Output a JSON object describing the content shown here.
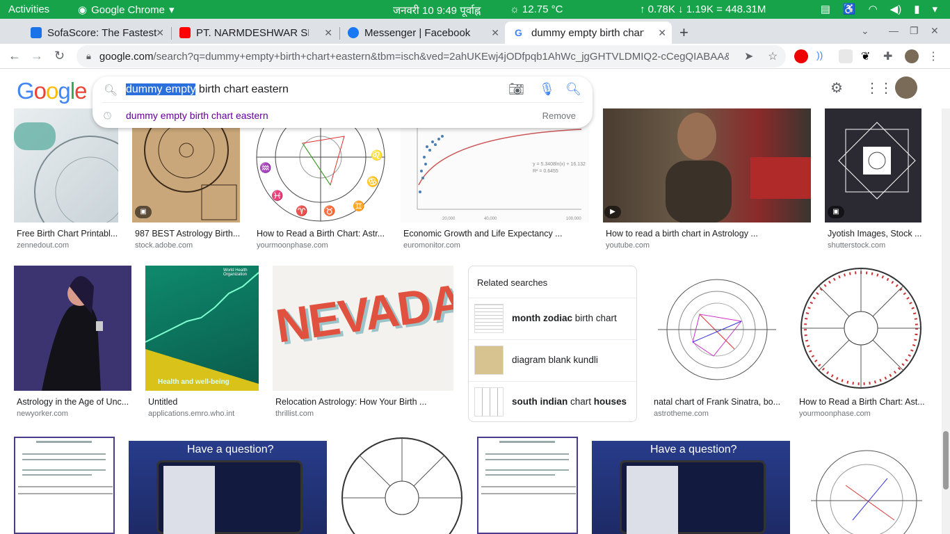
{
  "system_bar": {
    "activities": "Activities",
    "app": "Google Chrome",
    "clock": "जनवरी 10  9:49 पूर्वाह्न",
    "weather": "12.75 °C",
    "network": "↑ 0.78K ↓ 1.19K = 448.31M"
  },
  "tabs": [
    {
      "title": "SofaScore: The Fastest Fo",
      "color": "#1a73e8"
    },
    {
      "title": "PT. NARMDESHWAR SHAS",
      "color": "#ff0000"
    },
    {
      "title": "Messenger | Facebook",
      "color": "#1877f2"
    },
    {
      "title": "dummy empty birth chart",
      "color": "#4285f4"
    }
  ],
  "url": {
    "domain": "google.com",
    "path": "/search?q=dummy+empty+birth+chart+eastern&tbm=isch&ved=2ahUKEwj4jODfpqb1AhWc_jgGHTVLDMIQ2-cCegQIABAA&oq=du..."
  },
  "search": {
    "query_selected": "dummy empty",
    "query_rest": " birth chart eastern",
    "suggestion": "dummy empty birth chart eastern",
    "remove": "Remove"
  },
  "results_row1": [
    {
      "caption": "Free Birth Chart Printabl...",
      "source": "zennedout.com"
    },
    {
      "caption": "987 BEST Astrology Birth...",
      "source": "stock.adobe.com"
    },
    {
      "caption": "How to Read a Birth Chart: Astr...",
      "source": "yourmoonphase.com"
    },
    {
      "caption": "Economic Growth and Life Expectancy ...",
      "source": "euromonitor.com"
    },
    {
      "caption": "How to read a birth chart in Astrology ...",
      "source": "youtube.com"
    },
    {
      "caption": "Jyotish Images, Stock ...",
      "source": "shutterstock.com"
    }
  ],
  "results_row2": [
    {
      "caption": "Astrology in the Age of Unc...",
      "source": "newyorker.com"
    },
    {
      "caption": "Untitled",
      "source": "applications.emro.who.int"
    },
    {
      "caption": "Relocation Astrology: How Your Birth ...",
      "source": "thrillist.com"
    },
    {
      "caption": "natal chart of Frank Sinatra, bo...",
      "source": "astrotheme.com"
    },
    {
      "caption": "How to Read a Birth Chart: Ast...",
      "source": "yourmoonphase.com"
    }
  ],
  "related": {
    "heading": "Related searches",
    "items": [
      {
        "bold": "month zodiac",
        "rest": " birth chart"
      },
      {
        "bold": "",
        "rest": "diagram blank kundli"
      },
      {
        "bold": "south indian",
        "rest": " chart ",
        "bold2": "houses"
      }
    ]
  },
  "thumb_text": {
    "nevada": "NEVADA",
    "question": "Have a question?",
    "who_org": "World Health Organization",
    "health": "Health and well-being"
  }
}
